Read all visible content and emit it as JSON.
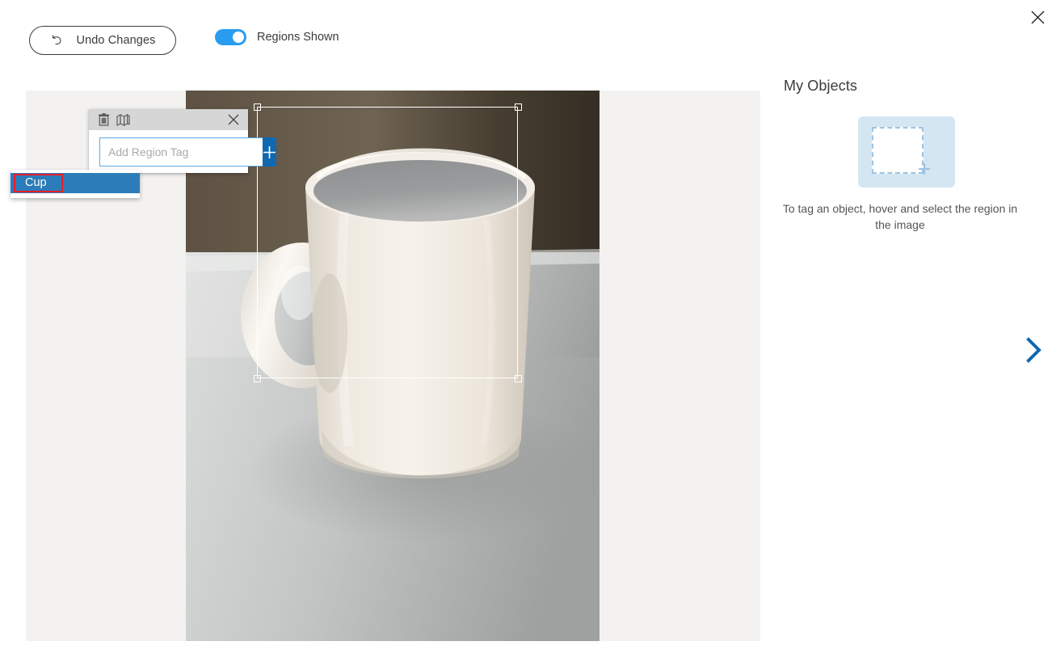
{
  "window": {
    "close_label": "close-icon"
  },
  "toolbar": {
    "undo_label": "Undo Changes",
    "undo_icon": "undo-arrow-icon",
    "regions_toggle_label": "Regions Shown",
    "regions_toggle_on": true,
    "toggle_on_color": "#2a9cf0"
  },
  "canvas": {
    "background_color": "#f3f2f1",
    "image_alt": "white ceramic coffee mug on a light grey table",
    "region": {
      "selected": true,
      "stroke_color": "#ffffff",
      "handles": 4
    }
  },
  "tag_popup": {
    "header": {
      "delete_icon": "trash-icon",
      "copy_regions_icon": "copy-regions-icon",
      "close_icon": "close-icon",
      "background_color": "#d6d6d6"
    },
    "input": {
      "value": "",
      "placeholder": "Add Region Tag"
    },
    "add_button_icon": "plus-icon",
    "add_button_color": "#1068b0",
    "dropdown": {
      "highlight_color": "#ee1c25",
      "selected_color": "#2b7cb9",
      "options": [
        {
          "label": "Cup",
          "highlighted": true
        }
      ]
    }
  },
  "right_panel": {
    "title": "My Objects",
    "placeholder_icon": "add-region-placeholder-icon",
    "placeholder_caption": "To tag an object, hover and select the region in the image",
    "tile_color": "#d5e6f3"
  },
  "navigation": {
    "next_icon": "chevron-right-icon",
    "next_color": "#1068b0"
  }
}
